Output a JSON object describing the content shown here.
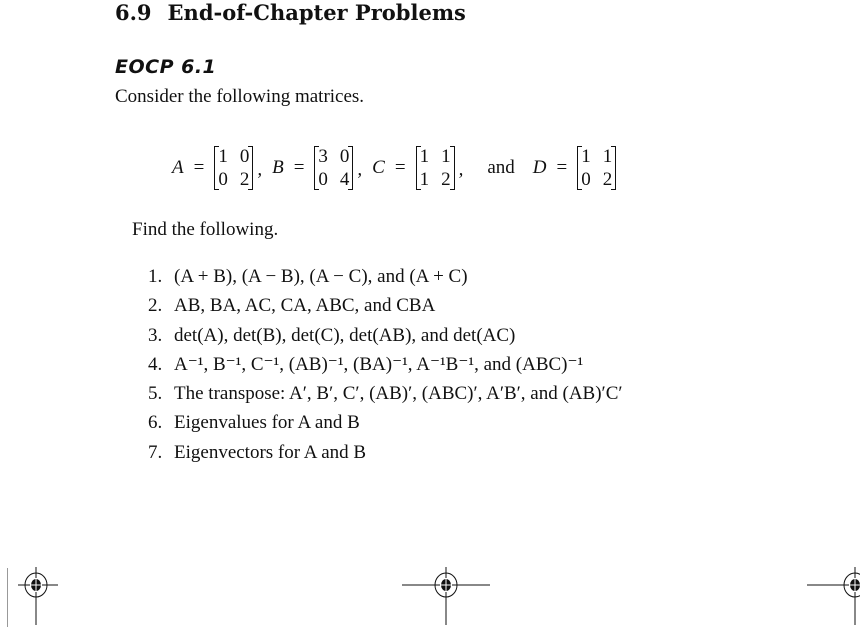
{
  "section": {
    "number": "6.9",
    "title": "End-of-Chapter Problems"
  },
  "problem": {
    "label": "EOCP 6.1",
    "intro": "Consider the following matrices.",
    "matrices": [
      {
        "name": "A",
        "rows": [
          [
            "1",
            "0"
          ],
          [
            "0",
            "2"
          ]
        ]
      },
      {
        "name": "B",
        "rows": [
          [
            "3",
            "0"
          ],
          [
            "0",
            "4"
          ]
        ]
      },
      {
        "name": "C",
        "rows": [
          [
            "1",
            "1"
          ],
          [
            "1",
            "2"
          ]
        ]
      },
      {
        "name": "D",
        "rows": [
          [
            "1",
            "1"
          ],
          [
            "0",
            "2"
          ]
        ]
      }
    ],
    "equals": "=",
    "comma": ",",
    "and_word": "and",
    "find": "Find the following.",
    "items": [
      {
        "n": "1.",
        "text": "(A + B), (A − B), (A − C), and (A + C)"
      },
      {
        "n": "2.",
        "text": "AB, BA, AC, CA, ABC, and CBA"
      },
      {
        "n": "3.",
        "text": "det(A), det(B), det(C), det(AB), and det(AC)"
      },
      {
        "n": "4.",
        "text": "A⁻¹, B⁻¹, C⁻¹, (AB)⁻¹, (BA)⁻¹, A⁻¹B⁻¹, and (ABC)⁻¹"
      },
      {
        "n": "5.",
        "text": "The transpose: A′, B′, C′, (AB)′, (ABC)′, A′B′, and (AB)′C′"
      },
      {
        "n": "6.",
        "text": "Eigenvalues for A and B"
      },
      {
        "n": "7.",
        "text": "Eigenvectors for A and B"
      }
    ]
  },
  "print_marks": [
    "registration-mark-left",
    "registration-mark-center",
    "registration-mark-right"
  ]
}
